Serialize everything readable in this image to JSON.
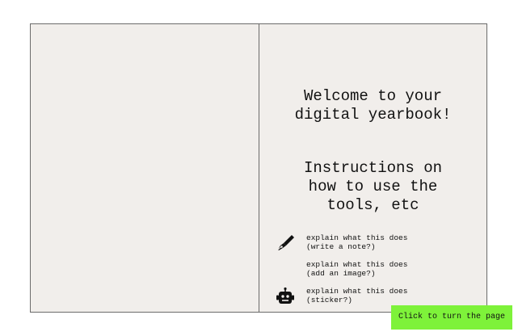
{
  "welcome": {
    "title": "Welcome to your\ndigital yearbook!"
  },
  "instructions": {
    "heading": "Instructions on\nhow to use the\ntools, etc"
  },
  "tools": [
    {
      "icon": "pen-icon",
      "text": "explain what this does\n(write a note?)"
    },
    {
      "icon": "image-icon",
      "text": "explain what this does\n(add an image?)"
    },
    {
      "icon": "robot-icon",
      "text": "explain what this does\n(sticker?)"
    }
  ],
  "turn_page_button": {
    "label": "Click to turn the page",
    "color": "#7ef23a"
  },
  "colors": {
    "page_background": "#f1eeeb",
    "border": "#6b6b6b"
  }
}
